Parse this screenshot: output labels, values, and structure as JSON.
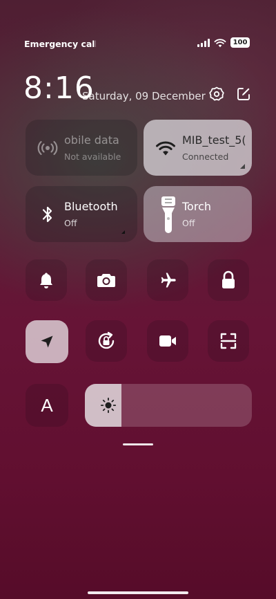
{
  "status_bar": {
    "carrier_text": "Emergency calls o",
    "battery_level": "100",
    "icons": [
      "signal-icon",
      "wifi-icon",
      "battery-icon"
    ]
  },
  "header": {
    "time": "8:16",
    "date": "Saturday, 09 December",
    "icons": [
      "settings-icon",
      "edit-icon"
    ]
  },
  "tiles": {
    "mobile_data": {
      "title": "obile data",
      "subtitle": "Not available",
      "icon": "mobile-data-icon",
      "state": "disabled"
    },
    "wifi": {
      "title": "MIB_test_5(",
      "subtitle": "Connected",
      "icon": "wifi-icon",
      "state": "on"
    },
    "bluetooth": {
      "title": "Bluetooth",
      "subtitle": "Off",
      "icon": "bluetooth-icon",
      "state": "off"
    },
    "torch": {
      "title": "Torch",
      "subtitle": "Off",
      "icon": "torch-icon",
      "state": "on"
    }
  },
  "quick_toggles": [
    {
      "name": "bell-icon",
      "active": false
    },
    {
      "name": "camera-icon",
      "active": false
    },
    {
      "name": "airplane-icon",
      "active": false
    },
    {
      "name": "lock-icon",
      "active": false
    },
    {
      "name": "location-icon",
      "active": true
    },
    {
      "name": "rotation-lock-icon",
      "active": false
    },
    {
      "name": "video-camera-icon",
      "active": false
    },
    {
      "name": "scan-icon",
      "active": false
    }
  ],
  "font_button": {
    "label": "A"
  },
  "brightness": {
    "level": 0.22,
    "icon": "sun-icon"
  },
  "colors": {
    "background": "#661436",
    "tile_light": "#d2cdd2",
    "text_on_light": "#2a2a2a"
  }
}
